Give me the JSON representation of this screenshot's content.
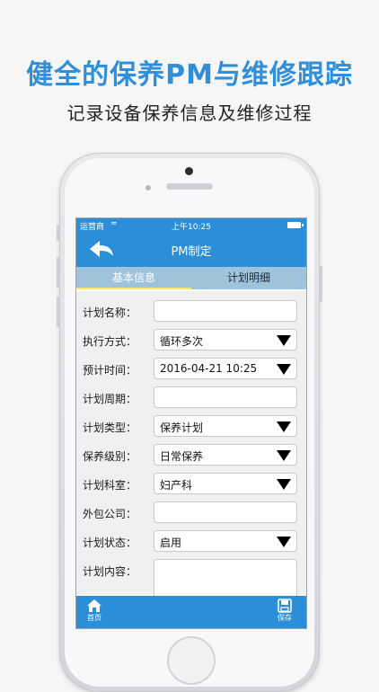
{
  "promo": {
    "headline": "健全的保养PM与维修跟踪",
    "subline": "记录设备保养信息及维修过程"
  },
  "status_bar": {
    "carrier": "运营商",
    "time": "上午10:25"
  },
  "nav": {
    "title": "PM制定",
    "back_icon": "back-arrow-icon"
  },
  "tabs": [
    {
      "label": "基本信息",
      "active": true
    },
    {
      "label": "计划明细",
      "active": false
    }
  ],
  "form": {
    "rows": [
      {
        "label": "计划名称：",
        "value": "",
        "type": "text"
      },
      {
        "label": "执行方式：",
        "value": "循环多次",
        "type": "select"
      },
      {
        "label": "预计时间：",
        "value": "2016-04-21 10:25",
        "type": "select"
      },
      {
        "label": "计划周期：",
        "value": "",
        "type": "text"
      },
      {
        "label": "计划类型：",
        "value": "保养计划",
        "type": "select"
      },
      {
        "label": "保养级别：",
        "value": "日常保养",
        "type": "select"
      },
      {
        "label": "计划科室：",
        "value": "妇产科",
        "type": "select"
      },
      {
        "label": "外包公司：",
        "value": "",
        "type": "text"
      },
      {
        "label": "计划状态：",
        "value": "启用",
        "type": "select"
      },
      {
        "label": "计划内容：",
        "value": "",
        "type": "textarea"
      }
    ]
  },
  "bottom_bar": {
    "home_label": "首页",
    "save_label": "保存"
  },
  "colors": {
    "accent": "#2a8fd8",
    "headline": "#2f8fd8",
    "tab_bg": "#9ec3da",
    "tab_indicator": "#f7e46a"
  }
}
